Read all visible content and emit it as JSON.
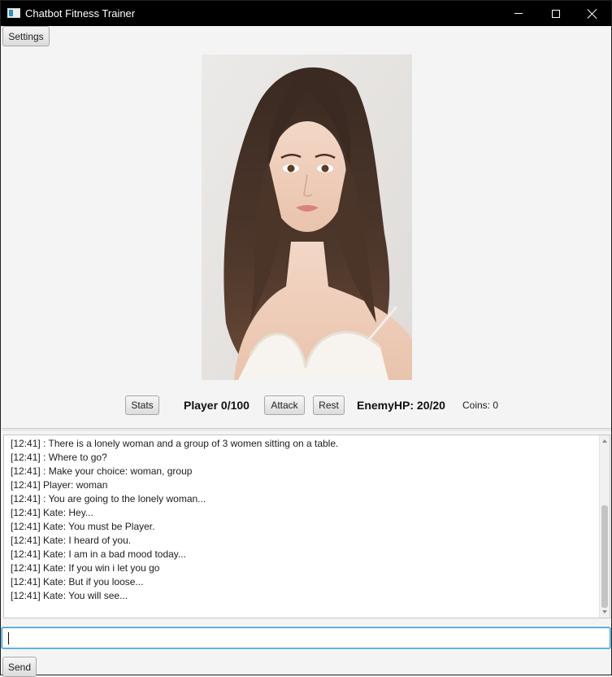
{
  "window": {
    "title": "Chatbot Fitness Trainer",
    "icon": "app-icon",
    "controls": [
      "minimize-icon",
      "maximize-icon",
      "close-icon"
    ]
  },
  "toolbar": {
    "settings_label": "Settings"
  },
  "stats_bar": {
    "stats_label": "Stats",
    "player_hp": "Player 0/100",
    "attack_label": "Attack",
    "rest_label": "Rest",
    "enemy_hp": "EnemyHP: 20/20",
    "coins": "Coins: 0"
  },
  "chat": {
    "lines": [
      "[12:41] : There is a lonely woman and a group of 3 women sitting on a table.",
      "[12:41] : Where to go?",
      "[12:41] : Make your choice: woman, group",
      "[12:41] Player: woman",
      "[12:41] : You are going to the lonely woman...",
      "[12:41] Kate: Hey...",
      "[12:41] Kate: You must be Player.",
      "[12:41] Kate: I heard of you.",
      "[12:41] Kate: I am in a bad mood today...",
      "[12:41] Kate: If you win i let you go",
      "[12:41] Kate: But if you loose...",
      "[12:41] Kate: You will see..."
    ],
    "input_value": "",
    "send_label": "Send"
  },
  "colors": {
    "titlebar": "#000000",
    "window_bg": "#f4f4f4",
    "input_focus": "#3c9ad2"
  }
}
